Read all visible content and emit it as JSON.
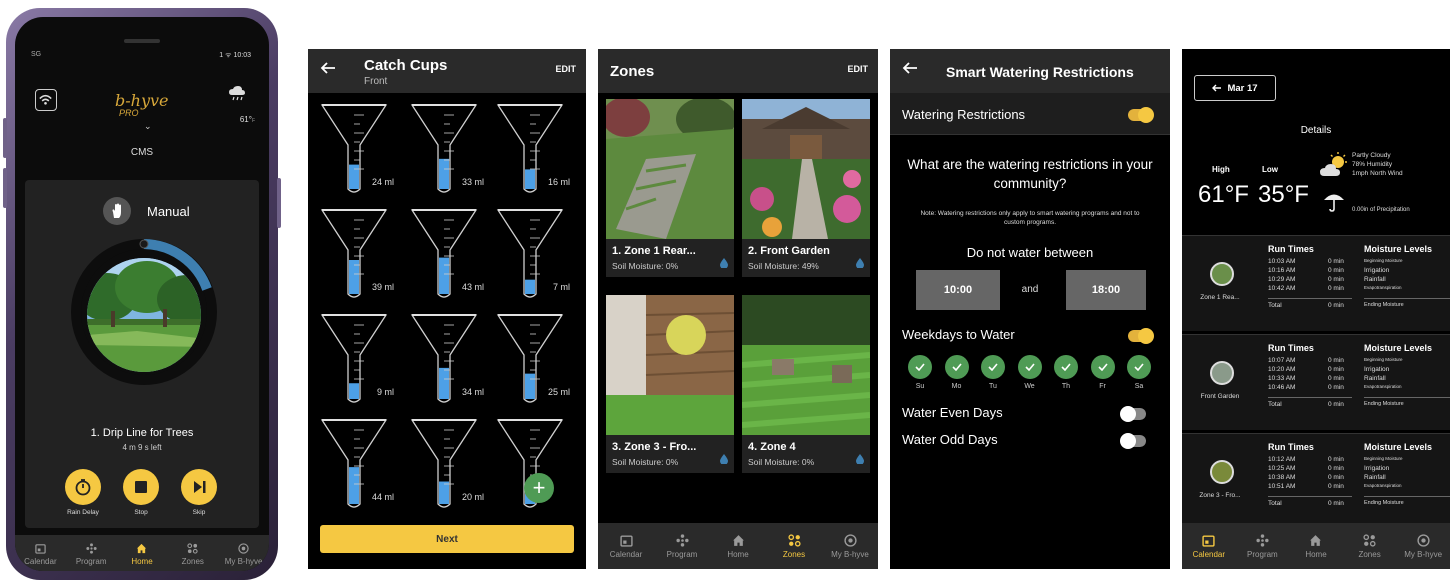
{
  "phone": {
    "status_left": "SG",
    "status_right": "1 ᯤ 10:03",
    "brand": "b-hyve",
    "brand_sub": "PRO",
    "temp": "61°",
    "temp_unit": "F",
    "site": "CMS",
    "mode_label": "Manual",
    "zone_name": "1. Drip Line for Trees",
    "time_left": "4 m 9 s left",
    "actions": [
      {
        "label": "Rain Delay"
      },
      {
        "label": "Stop"
      },
      {
        "label": "Skip"
      }
    ],
    "nav": [
      "Calendar",
      "Program",
      "Home",
      "Zones",
      "My B-hyve"
    ]
  },
  "catch_cups": {
    "title": "Catch Cups",
    "subtitle": "Front",
    "edit": "EDIT",
    "cups": [
      {
        "label": "24 ml",
        "fill": 0.3
      },
      {
        "label": "33 ml",
        "fill": 0.42
      },
      {
        "label": "16 ml",
        "fill": 0.2
      },
      {
        "label": "39 ml",
        "fill": 0.5
      },
      {
        "label": "43 ml",
        "fill": 0.55
      },
      {
        "label": "7 ml",
        "fill": 0.09
      },
      {
        "label": "9 ml",
        "fill": 0.12
      },
      {
        "label": "34 ml",
        "fill": 0.44
      },
      {
        "label": "25 ml",
        "fill": 0.32
      },
      {
        "label": "44 ml",
        "fill": 0.56
      },
      {
        "label": "20 ml",
        "fill": 0.26
      },
      {
        "label": "",
        "fill": 0.1
      }
    ],
    "next_label": "Next"
  },
  "zones": {
    "title": "Zones",
    "edit": "EDIT",
    "cards": [
      {
        "name": "1. Zone 1 Rear...",
        "moisture": "Soil Moisture: 0%"
      },
      {
        "name": "2. Front Garden",
        "moisture": "Soil Moisture: 49%"
      },
      {
        "name": "3. Zone 3 - Fro...",
        "moisture": "Soil Moisture: 0%"
      },
      {
        "name": "4. Zone 4",
        "moisture": "Soil Moisture: 0%"
      }
    ],
    "nav": [
      "Calendar",
      "Program",
      "Home",
      "Zones",
      "My B-hyve"
    ]
  },
  "restrictions": {
    "title": "Smart Watering Restrictions",
    "watering_restrictions": "Watering Restrictions",
    "question": "What are the watering restrictions in your community?",
    "note": "Note: Watering restrictions only apply to smart watering programs and not to custom programs.",
    "do_not_water": "Do not water between",
    "from": "10:00",
    "and": "and",
    "to": "18:00",
    "weekdays": "Weekdays to Water",
    "days": [
      "Su",
      "Mo",
      "Tu",
      "We",
      "Th",
      "Fr",
      "Sa"
    ],
    "even_days": "Water Even Days",
    "odd_days": "Water Odd Days"
  },
  "details": {
    "date_btn": "Mar 17",
    "title": "Details",
    "high_label": "High",
    "low_label": "Low",
    "high": "61°F",
    "low": "35°F",
    "weather": [
      "Partly Cloudy",
      "78% Humidity",
      "1mph North Wind"
    ],
    "precip": "0.00in of Precipitation",
    "blocks": [
      {
        "zone": "Zone 1 Rea...",
        "times": [
          "10:03 AM",
          "10:16 AM",
          "10:29 AM",
          "10:42 AM"
        ]
      },
      {
        "zone": "Front Garden",
        "times": [
          "10:07 AM",
          "10:20 AM",
          "10:33 AM",
          "10:46 AM"
        ]
      },
      {
        "zone": "Zone 3 - Fro...",
        "times": [
          "10:12 AM",
          "10:25 AM",
          "10:38 AM",
          "10:51 AM"
        ]
      }
    ],
    "run_times": "Run Times",
    "moisture_levels": "Moisture Levels",
    "min": "0 min",
    "total": "Total",
    "total_min": "0 min",
    "beginning": "Beginning Moisture",
    "irrigation": "Irrigation",
    "rainfall": "Rainfall",
    "evap": "Evapotranspiration",
    "ending": "Ending Moisture",
    "nav": [
      "Calendar",
      "Program",
      "Home",
      "Zones",
      "My B-hyve"
    ]
  }
}
